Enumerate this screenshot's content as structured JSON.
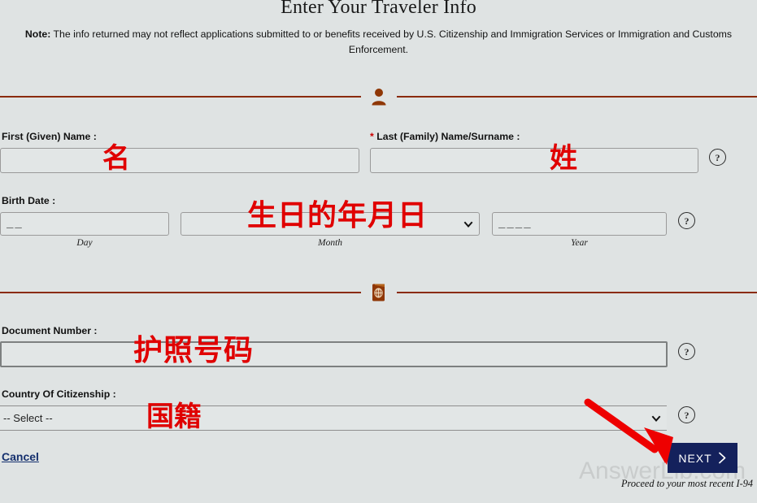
{
  "page": {
    "title": "Enter Your Traveler Info",
    "note_prefix": "Note:",
    "note_text": " The info returned may not reflect applications submitted to or benefits received by U.S. Citizenship and Immigration Services or Immigration and Customs Enforcement.",
    "background_color": "#dfe3e3",
    "divider_color": "#8a2b09",
    "accent_button_color": "#14215c",
    "annotation_color": "#e00000"
  },
  "sections": {
    "traveler": {
      "icon": "person-icon"
    },
    "document": {
      "icon": "passport-icon"
    }
  },
  "fields": {
    "first_name": {
      "label": "First (Given) Name :",
      "value": "",
      "placeholder": ""
    },
    "last_name": {
      "label": "Last (Family) Name/Surname :",
      "required_marker": "*",
      "value": "",
      "placeholder": ""
    },
    "birth_date": {
      "label": "Birth Date :",
      "day": {
        "value": "__",
        "sub_label": "Day"
      },
      "month": {
        "value": "",
        "sub_label": "Month",
        "placeholder": ""
      },
      "year": {
        "value": "____",
        "sub_label": "Year"
      }
    },
    "document_number": {
      "label": "Document Number :",
      "value": "",
      "placeholder": ""
    },
    "country_of_citizenship": {
      "label": "Country Of Citizenship :",
      "value": "-- Select --"
    }
  },
  "help": {
    "glyph": "?",
    "name_row": "?",
    "birth_row": "?",
    "document_row": "?",
    "citizenship_row": "?"
  },
  "actions": {
    "cancel": "Cancel",
    "next": "NEXT",
    "proceed_hint": "Proceed to your most recent I-94"
  },
  "annotations": {
    "first_name_cn": "名",
    "last_name_cn": "姓",
    "birth_date_cn": "生日的年月日",
    "document_number_cn": "护照号码",
    "citizenship_cn": "国籍",
    "arrow": "red-arrow-pointing-to-next-button"
  },
  "watermark": {
    "text": "AnswerLib.com"
  }
}
